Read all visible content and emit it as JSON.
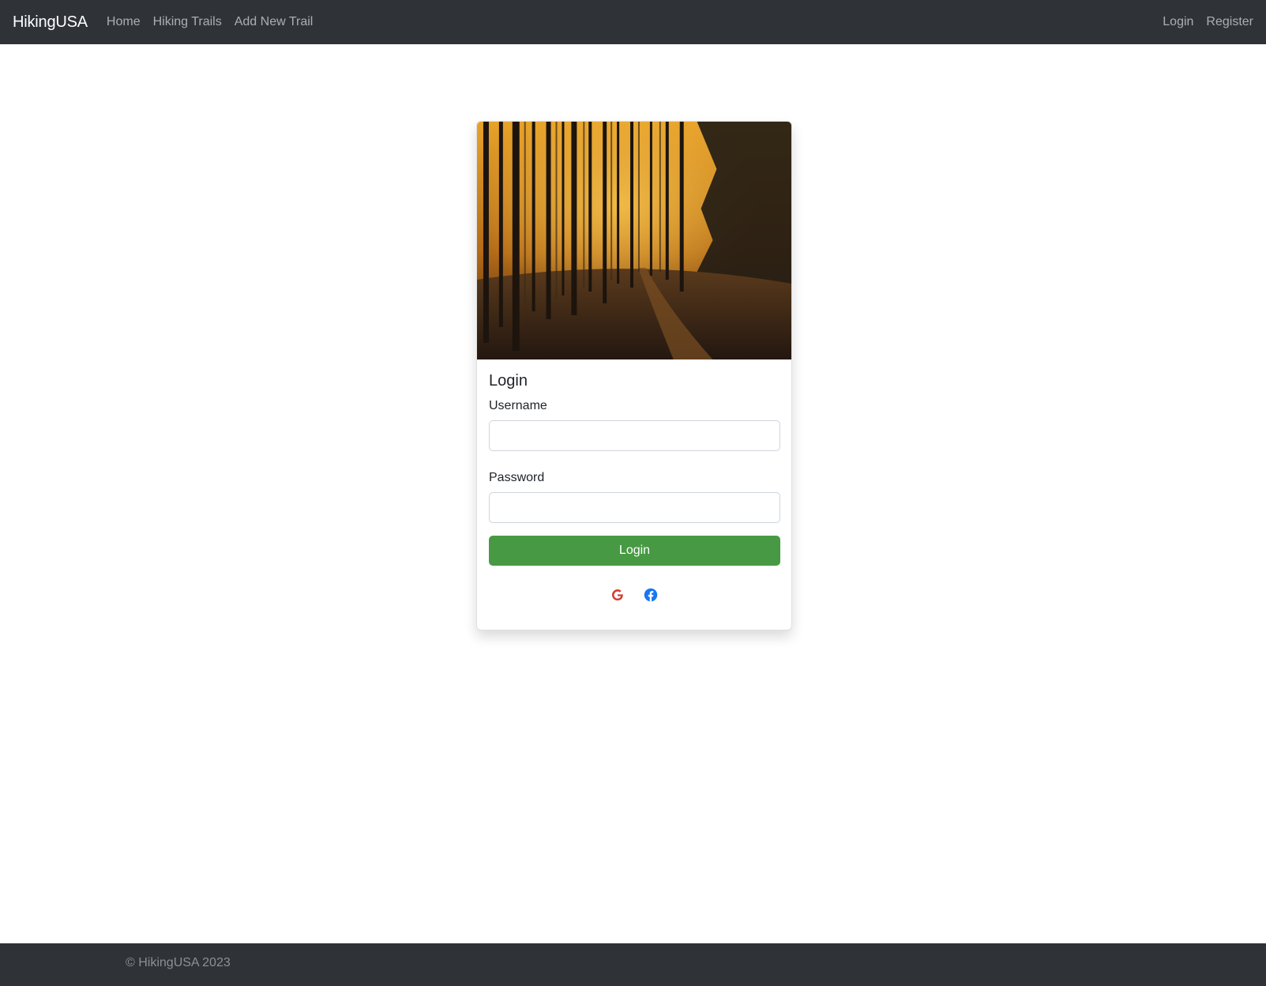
{
  "navbar": {
    "brand": "HikingUSA",
    "links": [
      "Home",
      "Hiking Trails",
      "Add New Trail"
    ],
    "right_links": [
      "Login",
      "Register"
    ]
  },
  "login_card": {
    "image_icon": "forest-trail-photo",
    "title": "Login",
    "username_label": "Username",
    "username_value": "",
    "password_label": "Password",
    "password_value": "",
    "submit_label": "Login",
    "submit_color": "#479943",
    "social": [
      {
        "icon": "google-icon",
        "color": "#d23f31"
      },
      {
        "icon": "facebook-icon",
        "color": "#1877f2"
      }
    ]
  },
  "footer": {
    "text": "© HikingUSA 2023"
  }
}
